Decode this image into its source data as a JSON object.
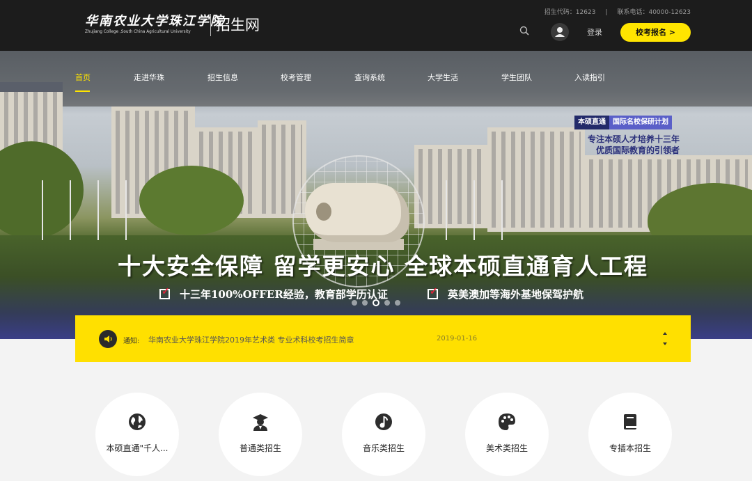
{
  "header": {
    "logo_cn": "华南农业大学珠江学院",
    "logo_en": "Zhujiang College ,South China Agricultural University",
    "site_name": "招生网",
    "code_text": "招生代码：12623",
    "separator": "|",
    "phone_text": "联系电话：40000-12623",
    "login_label": "登录",
    "apply_label": "校考报名 >"
  },
  "nav": {
    "items": [
      {
        "label": "首页",
        "active": true
      },
      {
        "label": "走进华珠"
      },
      {
        "label": "招生信息"
      },
      {
        "label": "校考管理"
      },
      {
        "label": "查询系统"
      },
      {
        "label": "大学生活"
      },
      {
        "label": "学生团队"
      },
      {
        "label": "入读指引"
      }
    ]
  },
  "banner": {
    "badge_left": "本硕直通",
    "badge_right": "国际名校保研计划",
    "tagline_1": "专注本硕人才培养十三年",
    "tagline_2": "优质国际教育的引领者",
    "headline": "十大安全保障 留学更安心 全球本硕直通育人工程",
    "perk_1": "十三年100%OFFER经验，教育部学历认证",
    "perk_2": "英美澳加等海外基地保驾护航",
    "slides": 5,
    "active_slide": 3
  },
  "notice": {
    "label": "通知:",
    "text": "华南农业大学珠江学院2019年艺术类 专业术科校考招生简章",
    "date": "2019-01-16"
  },
  "categories": [
    {
      "label": "本硕直通\"千人...",
      "icon": "globe-icon"
    },
    {
      "label": "普通类招生",
      "icon": "graduate-icon"
    },
    {
      "label": "音乐类招生",
      "icon": "music-note-icon"
    },
    {
      "label": "美术类招生",
      "icon": "palette-icon"
    },
    {
      "label": "专插本招生",
      "icon": "book-icon"
    }
  ],
  "colors": {
    "accent": "#ffe500",
    "topbar": "#1c1c1c",
    "badge_dark": "#222a6a",
    "badge_light": "#5a5fc8"
  }
}
